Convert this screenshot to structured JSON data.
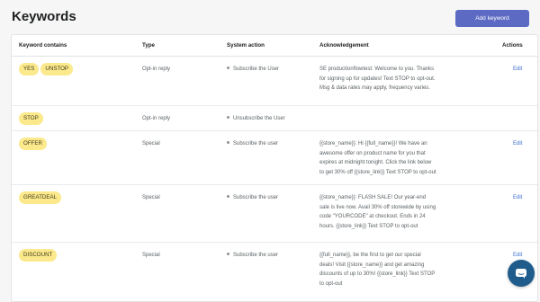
{
  "header": {
    "title": "Keywords",
    "add_button_label": "Add keyword"
  },
  "table": {
    "columns": [
      "Keyword contains",
      "Type",
      "System action",
      "Acknowledgement",
      "Actions"
    ],
    "rows": [
      {
        "keywords": [
          "YES",
          "UNSTOP"
        ],
        "type": "Opt-in reply",
        "system_action": "Subscribe the User",
        "acknowledgement": "SE productionflowtest: Welcome to you. Thanks for signing up for updates! Text STOP to opt-out. Msg & data rates may apply, frequency varies.",
        "action": "Edit"
      },
      {
        "keywords": [
          "STOP"
        ],
        "type": "Opt-in reply",
        "system_action": "Unsubscribe the User",
        "acknowledgement": "",
        "action": ""
      },
      {
        "keywords": [
          "OFFER"
        ],
        "type": "Special",
        "system_action": "Subscribe the user",
        "acknowledgement": "{{store_name}}: Hi {{full_name}}! We have an awesome offer on product name for you that expires at midnight tonight. Click the link below to get 30% off {{store_link}} Text STOP to opt-out",
        "action": "Edit"
      },
      {
        "keywords": [
          "GREATDEAL"
        ],
        "type": "Special",
        "system_action": "Subscribe the user",
        "acknowledgement": "{{store_name}}: FLASH SALE! Our year-end sale is live now. Avail 30% off storewide by using code \"YOURCODE\" at checkout. Ends in 24 hours. {{store_link}} Text STOP to opt-out",
        "action": "Edit"
      },
      {
        "keywords": [
          "DISCOUNT"
        ],
        "type": "Special",
        "system_action": "Subscribe the user",
        "acknowledgement": "{{full_name}}, be the first to get our special deals! Visit {{store_name}} and get amazing discounts of up to 30%! {{store_link}} Text STOP to opt-out",
        "action": "Edit"
      }
    ]
  },
  "chat": {
    "icon": "chat-bubble-icon"
  },
  "colors": {
    "accent": "#5c6ac4",
    "badge": "#fbe98c",
    "link": "#3b6fd0",
    "chat": "#1f5c8c"
  }
}
